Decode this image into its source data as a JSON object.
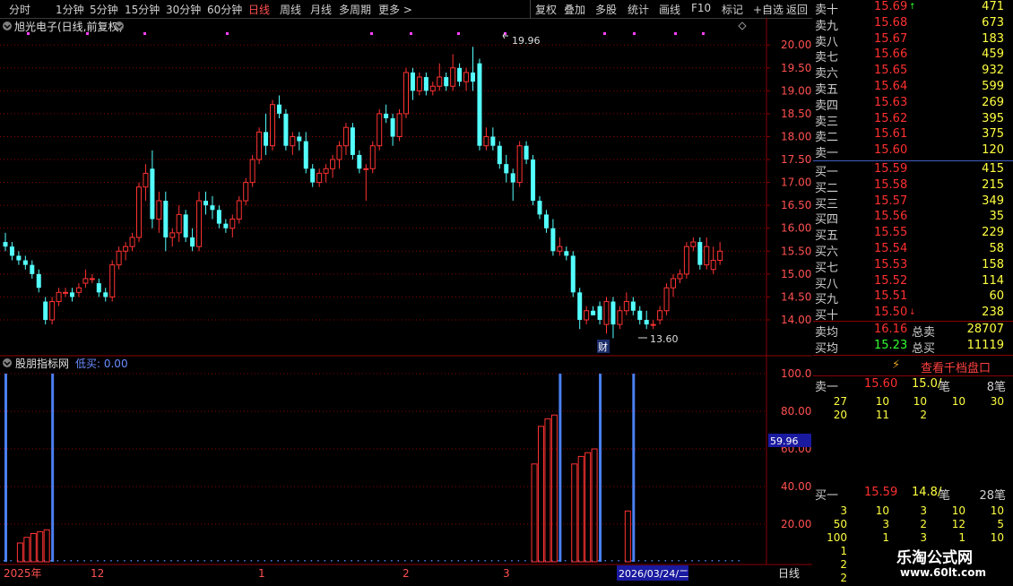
{
  "toolbar": {
    "periods": [
      "分时",
      "1分钟",
      "5分钟",
      "15分钟",
      "30分钟",
      "60分钟",
      "日线",
      "周线",
      "月线",
      "多周期",
      "更多 >"
    ],
    "active_period": "日线",
    "actions": [
      "复权",
      "叠加",
      "多股",
      "统计",
      "画线",
      "F10",
      "标记",
      "+自选",
      "返回"
    ]
  },
  "chart": {
    "title": "旭光电子(日线,前复权)",
    "price_ticks": [
      "20.00",
      "19.50",
      "19.00",
      "18.50",
      "18.00",
      "17.50",
      "17.00",
      "16.50",
      "16.00",
      "15.50",
      "15.00",
      "14.50",
      "14.00"
    ],
    "high_label": "19.96",
    "low_label": "13.60",
    "cai_label": "财",
    "indicator_name": "股朋指标网",
    "indicator_value": "低买: 0.00",
    "indicator_ticks": [
      "100.0",
      "80.00",
      "60.00",
      "40.00",
      "20.00"
    ],
    "indicator_cursor": "59.96",
    "date_labels": [
      "2025年",
      "12",
      "1",
      "2",
      "3"
    ],
    "cursor_date": "2026/03/24/二",
    "period_tag": "日线"
  },
  "chart_data": {
    "type": "candlestick",
    "candles": [
      [
        15.7,
        15.9,
        15.5,
        15.6
      ],
      [
        15.6,
        15.7,
        15.3,
        15.4
      ],
      [
        15.4,
        15.5,
        15.2,
        15.3
      ],
      [
        15.3,
        15.4,
        15.1,
        15.2
      ],
      [
        15.2,
        15.3,
        14.9,
        15.0
      ],
      [
        15.0,
        15.1,
        14.6,
        14.7
      ],
      [
        14.4,
        14.5,
        13.9,
        14.0
      ],
      [
        14.0,
        14.5,
        13.9,
        14.4
      ],
      [
        14.4,
        14.7,
        14.3,
        14.6
      ],
      [
        14.6,
        14.7,
        14.5,
        14.6
      ],
      [
        14.6,
        14.7,
        14.4,
        14.5
      ],
      [
        14.6,
        14.8,
        14.5,
        14.7
      ],
      [
        14.8,
        15.1,
        14.7,
        14.9
      ],
      [
        14.9,
        15.0,
        14.8,
        14.9
      ],
      [
        14.8,
        14.9,
        14.5,
        14.6
      ],
      [
        14.6,
        14.7,
        14.4,
        14.5
      ],
      [
        14.5,
        15.3,
        14.4,
        15.2
      ],
      [
        15.2,
        15.6,
        15.1,
        15.5
      ],
      [
        15.5,
        15.7,
        15.3,
        15.6
      ],
      [
        15.6,
        15.9,
        15.5,
        15.8
      ],
      [
        15.8,
        17.0,
        15.7,
        16.9
      ],
      [
        16.9,
        17.4,
        16.6,
        17.2
      ],
      [
        17.3,
        17.7,
        16.0,
        16.2
      ],
      [
        16.2,
        16.8,
        15.9,
        16.6
      ],
      [
        16.6,
        16.8,
        15.5,
        15.8
      ],
      [
        15.8,
        16.0,
        15.6,
        15.9
      ],
      [
        15.9,
        16.5,
        15.7,
        16.3
      ],
      [
        16.3,
        16.4,
        15.7,
        15.8
      ],
      [
        15.8,
        16.0,
        15.5,
        15.6
      ],
      [
        15.6,
        16.8,
        15.5,
        16.6
      ],
      [
        16.6,
        16.8,
        16.3,
        16.5
      ],
      [
        16.5,
        16.7,
        16.2,
        16.4
      ],
      [
        16.4,
        16.5,
        16.0,
        16.1
      ],
      [
        16.1,
        16.2,
        15.9,
        16.0
      ],
      [
        16.0,
        16.3,
        15.8,
        16.2
      ],
      [
        16.2,
        16.7,
        16.1,
        16.6
      ],
      [
        16.6,
        17.1,
        16.5,
        17.0
      ],
      [
        17.0,
        17.6,
        16.9,
        17.5
      ],
      [
        17.5,
        18.2,
        17.4,
        18.1
      ],
      [
        18.1,
        18.5,
        17.6,
        17.8
      ],
      [
        17.8,
        18.8,
        17.7,
        18.7
      ],
      [
        18.7,
        18.9,
        18.4,
        18.5
      ],
      [
        18.5,
        18.6,
        17.7,
        17.8
      ],
      [
        17.8,
        18.1,
        17.6,
        18.0
      ],
      [
        18.0,
        18.1,
        17.7,
        17.9
      ],
      [
        17.9,
        18.1,
        17.2,
        17.3
      ],
      [
        17.3,
        17.4,
        16.9,
        17.0
      ],
      [
        17.0,
        17.3,
        16.9,
        17.2
      ],
      [
        17.2,
        17.4,
        17.0,
        17.3
      ],
      [
        17.3,
        17.6,
        17.1,
        17.5
      ],
      [
        17.5,
        17.9,
        17.3,
        17.8
      ],
      [
        17.8,
        18.3,
        17.6,
        18.2
      ],
      [
        18.2,
        18.3,
        17.5,
        17.6
      ],
      [
        17.6,
        17.7,
        17.2,
        17.3
      ],
      [
        17.3,
        17.4,
        16.6,
        17.3
      ],
      [
        17.3,
        17.9,
        17.2,
        17.8
      ],
      [
        17.8,
        18.6,
        17.7,
        18.5
      ],
      [
        18.5,
        18.7,
        18.3,
        18.4
      ],
      [
        18.4,
        18.5,
        17.8,
        18.0
      ],
      [
        18.0,
        18.6,
        17.9,
        18.5
      ],
      [
        18.5,
        19.5,
        18.4,
        19.4
      ],
      [
        19.4,
        19.5,
        18.8,
        19.0
      ],
      [
        19.0,
        19.4,
        18.9,
        19.3
      ],
      [
        19.3,
        19.4,
        18.9,
        19.0
      ],
      [
        19.0,
        19.2,
        18.9,
        19.1
      ],
      [
        19.1,
        19.6,
        19.0,
        19.3
      ],
      [
        19.3,
        19.4,
        19.0,
        19.1
      ],
      [
        19.1,
        19.8,
        19.0,
        19.5
      ],
      [
        19.5,
        19.6,
        19.1,
        19.2
      ],
      [
        19.2,
        19.5,
        19.0,
        19.4
      ],
      [
        19.4,
        19.96,
        19.0,
        19.2
      ],
      [
        19.6,
        19.7,
        17.7,
        17.8
      ],
      [
        17.8,
        18.2,
        17.7,
        18.0
      ],
      [
        18.0,
        18.2,
        17.7,
        17.8
      ],
      [
        17.8,
        17.9,
        17.3,
        17.4
      ],
      [
        17.4,
        17.6,
        17.0,
        17.2
      ],
      [
        17.2,
        17.3,
        16.6,
        17.0
      ],
      [
        17.0,
        17.9,
        16.9,
        17.8
      ],
      [
        17.8,
        17.9,
        17.4,
        17.5
      ],
      [
        17.5,
        17.6,
        16.5,
        16.6
      ],
      [
        16.6,
        16.7,
        16.2,
        16.3
      ],
      [
        16.3,
        16.4,
        15.9,
        16.0
      ],
      [
        16.0,
        16.2,
        15.4,
        15.5
      ],
      [
        15.5,
        15.8,
        15.4,
        15.6
      ],
      [
        15.5,
        15.6,
        15.3,
        15.4
      ],
      [
        15.4,
        15.5,
        14.5,
        14.6
      ],
      [
        14.6,
        14.7,
        13.8,
        14.0
      ],
      [
        14.0,
        14.3,
        13.9,
        14.2
      ],
      [
        14.2,
        14.3,
        14.1,
        14.1
      ],
      [
        14.3,
        14.4,
        13.9,
        14.0
      ],
      [
        13.9,
        14.5,
        13.7,
        14.4
      ],
      [
        14.4,
        14.5,
        13.6,
        13.9
      ],
      [
        13.9,
        14.3,
        13.8,
        14.2
      ],
      [
        14.2,
        14.6,
        14.1,
        14.4
      ],
      [
        14.4,
        14.5,
        14.1,
        14.2
      ],
      [
        14.2,
        14.3,
        13.9,
        14.0
      ],
      [
        14.0,
        14.2,
        13.8,
        13.9
      ],
      [
        13.9,
        14.0,
        13.8,
        13.9
      ],
      [
        14.0,
        14.3,
        13.9,
        14.2
      ],
      [
        14.2,
        14.8,
        14.1,
        14.7
      ],
      [
        14.7,
        15.0,
        14.5,
        14.9
      ],
      [
        14.9,
        15.1,
        14.8,
        15.0
      ],
      [
        15.0,
        15.7,
        14.9,
        15.6
      ],
      [
        15.6,
        15.8,
        15.5,
        15.7
      ],
      [
        15.7,
        15.8,
        15.1,
        15.2
      ],
      [
        15.2,
        15.8,
        15.1,
        15.6
      ],
      [
        15.1,
        15.6,
        15.0,
        15.3
      ],
      [
        15.3,
        15.7,
        15.2,
        15.5
      ]
    ],
    "bars": [
      {
        "i": 0,
        "v": 100,
        "c": "blue"
      },
      {
        "i": 2,
        "v": 10,
        "c": "red"
      },
      {
        "i": 3,
        "v": 13,
        "c": "red"
      },
      {
        "i": 4,
        "v": 15,
        "c": "red"
      },
      {
        "i": 5,
        "v": 16,
        "c": "red"
      },
      {
        "i": 6,
        "v": 17,
        "c": "red"
      },
      {
        "i": 7,
        "v": 100,
        "c": "blue"
      },
      {
        "i": 79,
        "v": 52,
        "c": "red"
      },
      {
        "i": 80,
        "v": 72,
        "c": "red"
      },
      {
        "i": 81,
        "v": 76,
        "c": "red"
      },
      {
        "i": 82,
        "v": 78,
        "c": "red"
      },
      {
        "i": 83,
        "v": 100,
        "c": "blue"
      },
      {
        "i": 85,
        "v": 52,
        "c": "red"
      },
      {
        "i": 86,
        "v": 56,
        "c": "red"
      },
      {
        "i": 87,
        "v": 58,
        "c": "red"
      },
      {
        "i": 88,
        "v": 60,
        "c": "red"
      },
      {
        "i": 89,
        "v": 100,
        "c": "blue"
      },
      {
        "i": 93,
        "v": 27,
        "c": "red"
      },
      {
        "i": 94,
        "v": 100,
        "c": "blue"
      }
    ],
    "ylim": [
      13.55,
      20.2
    ],
    "indicator_ylim": [
      0,
      100
    ]
  },
  "orderbook": {
    "asks": [
      {
        "label": "卖十",
        "price": "15.69",
        "vol": "471",
        "mark": "↑"
      },
      {
        "label": "卖九",
        "price": "15.68",
        "vol": "673"
      },
      {
        "label": "卖八",
        "price": "15.67",
        "vol": "183"
      },
      {
        "label": "卖七",
        "price": "15.66",
        "vol": "459"
      },
      {
        "label": "卖六",
        "price": "15.65",
        "vol": "932"
      },
      {
        "label": "卖五",
        "price": "15.64",
        "vol": "599"
      },
      {
        "label": "卖四",
        "price": "15.63",
        "vol": "269"
      },
      {
        "label": "卖三",
        "price": "15.62",
        "vol": "395"
      },
      {
        "label": "卖二",
        "price": "15.61",
        "vol": "375"
      },
      {
        "label": "卖一",
        "price": "15.60",
        "vol": "120"
      }
    ],
    "bids": [
      {
        "label": "买一",
        "price": "15.59",
        "vol": "415"
      },
      {
        "label": "买二",
        "price": "15.58",
        "vol": "215"
      },
      {
        "label": "买三",
        "price": "15.57",
        "vol": "349"
      },
      {
        "label": "买四",
        "price": "15.56",
        "vol": "35"
      },
      {
        "label": "买五",
        "price": "15.55",
        "vol": "229"
      },
      {
        "label": "买六",
        "price": "15.54",
        "vol": "58"
      },
      {
        "label": "买七",
        "price": "15.53",
        "vol": "158"
      },
      {
        "label": "买八",
        "price": "15.52",
        "vol": "114"
      },
      {
        "label": "买九",
        "price": "15.51",
        "vol": "60"
      },
      {
        "label": "买十",
        "price": "15.50",
        "vol": "238",
        "mark": "↓"
      }
    ],
    "avg_sell_label": "卖均",
    "avg_sell": "16.16",
    "total_sell_label": "总卖",
    "total_sell": "28707",
    "avg_buy_label": "买均",
    "avg_buy": "15.23",
    "total_buy_label": "总买",
    "total_buy": "11119",
    "view_thousand": "查看千档盘口",
    "queue_sell": {
      "label": "卖一",
      "price": "15.60",
      "avg": "15.0/",
      "unit": "笔",
      "count": "8笔",
      "rows": [
        [
          "27",
          "10",
          "10",
          "10",
          "30"
        ],
        [
          "20",
          "11",
          "2",
          "",
          ""
        ]
      ]
    },
    "queue_buy": {
      "label": "买一",
      "price": "15.59",
      "avg": "14.8/",
      "unit": "笔",
      "count": "28笔",
      "rows": [
        [
          "3",
          "10",
          "3",
          "10",
          "10"
        ],
        [
          "50",
          "3",
          "2",
          "12",
          "5"
        ],
        [
          "100",
          "1",
          "3",
          "1",
          "10"
        ],
        [
          "1",
          "",
          "",
          "",
          ""
        ],
        [
          "2",
          "",
          "",
          "",
          ""
        ],
        [
          "2",
          "",
          "",
          "",
          ""
        ]
      ]
    }
  },
  "watermark": {
    "name": "乐淘公式网",
    "url": "www.60lt.com"
  },
  "colors": {
    "up": "#ff3232",
    "down": "#54ffff",
    "bar_blue": "#4a7ff0",
    "bg": "#000000",
    "grid": "#8b0000"
  }
}
